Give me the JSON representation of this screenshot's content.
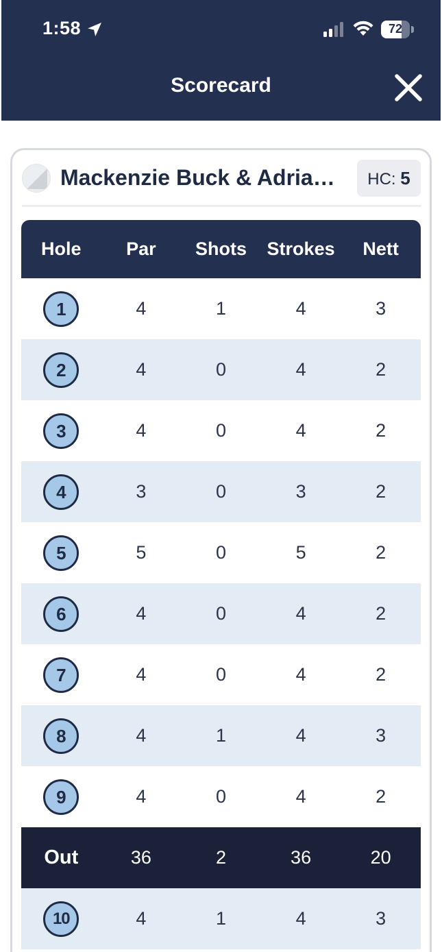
{
  "status_bar": {
    "time": "1:58",
    "battery": "72",
    "battery_level": 0.72
  },
  "header": {
    "title": "Scorecard"
  },
  "player": {
    "name": "Mackenzie Buck & Adrian…",
    "hc_label": "HC: ",
    "hc_value": "5"
  },
  "table": {
    "headers": [
      "Hole",
      "Par",
      "Shots",
      "Strokes",
      "Nett"
    ],
    "rows": [
      {
        "hole": "1",
        "par": "4",
        "shots": "1",
        "strokes": "4",
        "nett": "3"
      },
      {
        "hole": "2",
        "par": "4",
        "shots": "0",
        "strokes": "4",
        "nett": "2"
      },
      {
        "hole": "3",
        "par": "4",
        "shots": "0",
        "strokes": "4",
        "nett": "2"
      },
      {
        "hole": "4",
        "par": "3",
        "shots": "0",
        "strokes": "3",
        "nett": "2"
      },
      {
        "hole": "5",
        "par": "5",
        "shots": "0",
        "strokes": "5",
        "nett": "2"
      },
      {
        "hole": "6",
        "par": "4",
        "shots": "0",
        "strokes": "4",
        "nett": "2"
      },
      {
        "hole": "7",
        "par": "4",
        "shots": "0",
        "strokes": "4",
        "nett": "2"
      },
      {
        "hole": "8",
        "par": "4",
        "shots": "1",
        "strokes": "4",
        "nett": "3"
      },
      {
        "hole": "9",
        "par": "4",
        "shots": "0",
        "strokes": "4",
        "nett": "2"
      }
    ],
    "out": {
      "label": "Out",
      "par": "36",
      "shots": "2",
      "strokes": "36",
      "nett": "20"
    },
    "back_rows": [
      {
        "hole": "10",
        "par": "4",
        "shots": "1",
        "strokes": "4",
        "nett": "3"
      }
    ]
  },
  "colors": {
    "header_bg": "#23304f",
    "out_row_bg": "#1a2139",
    "alt_row_bg": "#e3ebf5",
    "hole_badge": "#a6c8e8"
  }
}
